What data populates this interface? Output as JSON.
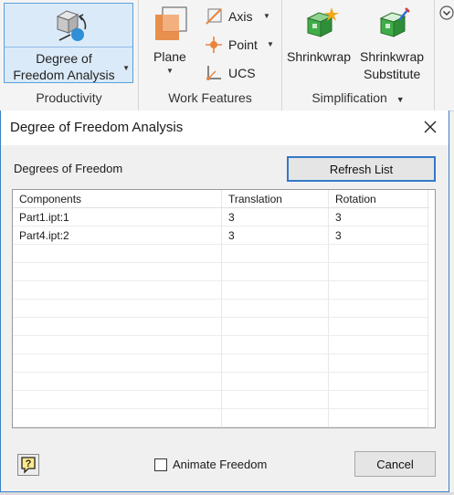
{
  "ribbon": {
    "productivity": {
      "title": "Productivity",
      "dof_button": {
        "line1": "Degree of",
        "line2": "Freedom Analysis",
        "icon": "dof-analysis-icon"
      }
    },
    "work_features": {
      "title": "Work Features",
      "plane_label": "Plane",
      "axis_label": "Axis",
      "point_label": "Point",
      "ucs_label": "UCS"
    },
    "simplification": {
      "title": "Simplification",
      "shrinkwrap_label": "Shrinkwrap",
      "substitute_line1": "Shrinkwrap",
      "substitute_line2": "Substitute"
    }
  },
  "dialog": {
    "title": "Degree of Freedom Analysis",
    "section_label": "Degrees of Freedom",
    "refresh_label": "Refresh List",
    "columns": [
      "Components",
      "Translation",
      "Rotation"
    ],
    "rows": [
      {
        "component": "Part1.ipt:1",
        "translation": "3",
        "rotation": "3"
      },
      {
        "component": "Part4.ipt:2",
        "translation": "3",
        "rotation": "3"
      }
    ],
    "animate_label": "Animate Freedom",
    "animate_checked": false,
    "cancel_label": "Cancel",
    "help_label": "?"
  },
  "colors": {
    "accent": "#3478c8",
    "selected_button_bg": "#dbeaf8",
    "plane_orange": "#e8843c",
    "shrinkwrap_green": "#3fae49"
  }
}
